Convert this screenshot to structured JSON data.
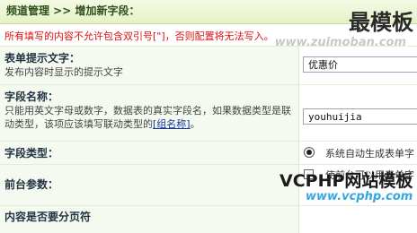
{
  "header": {
    "breadcrumb": "频道管理 >> 增加新字段："
  },
  "notice": "所有填写的内容不允许包含双引号[\"]，否则配置将无法写入。",
  "form": {
    "rows": [
      {
        "title": "表单提示文字：",
        "desc": "发布内容时显示的提示文字",
        "value": "优惠价"
      },
      {
        "title": "字段名称：",
        "desc": "只能用英文字母或数字，数据表的真实字段名，如果数据类型是联动类型，该项应该填写联动类型的",
        "link": "[组名称]",
        "desc_end": "。",
        "value": "youhuijia"
      },
      {
        "title": "字段类型：",
        "option_label": "系统自动生成表单字"
      },
      {
        "title": "前台参数：",
        "option_label": "使前台可以用表单字"
      },
      {
        "title": "内容是否要分页符"
      }
    ]
  },
  "watermarks": {
    "brand": "最模板",
    "brand_url": "www.zuimoban.com",
    "vcphp": "VCPHP网站模板",
    "vcphp_url": "www.vcphp.com"
  }
}
